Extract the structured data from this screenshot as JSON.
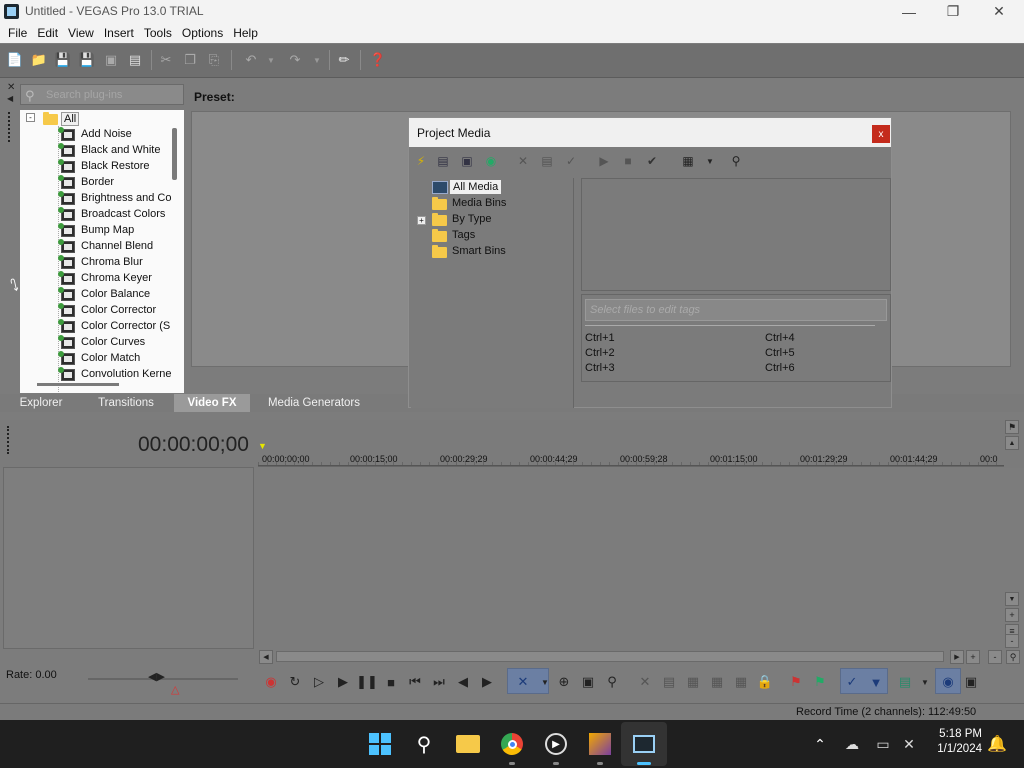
{
  "window": {
    "title": "Untitled - VEGAS Pro 13.0 TRIAL",
    "controls": [
      "minimize",
      "maximize",
      "close"
    ]
  },
  "menu": [
    "File",
    "Edit",
    "View",
    "Insert",
    "Tools",
    "Options",
    "Help"
  ],
  "plugins": {
    "search_placeholder": "Search plug-ins",
    "root": "All",
    "items": [
      "Add Noise",
      "Black and White",
      "Black Restore",
      "Border",
      "Brightness and Co",
      "Broadcast Colors",
      "Bump Map",
      "Channel Blend",
      "Chroma Blur",
      "Chroma Keyer",
      "Color Balance",
      "Color Corrector",
      "Color Corrector (S",
      "Color Curves",
      "Color Match",
      "Convolution Kerne"
    ]
  },
  "preset": {
    "label": "Preset:"
  },
  "tabs": [
    "Explorer",
    "Transitions",
    "Video FX",
    "Media Generators"
  ],
  "active_tab": "Video FX",
  "project_media": {
    "title": "Project Media",
    "close": "x",
    "tree": [
      "All Media",
      "Media Bins",
      "By Type",
      "Tags",
      "Smart Bins"
    ],
    "tags_placeholder": "Select files to edit tags",
    "shortcuts_left": [
      "Ctrl+1",
      "Ctrl+2",
      "Ctrl+3"
    ],
    "shortcuts_right": [
      "Ctrl+4",
      "Ctrl+5",
      "Ctrl+6"
    ]
  },
  "timeline": {
    "timecode": "00:00:00;00",
    "ruler": [
      "00:00:00;00",
      "00:00:15;00",
      "00:00:29;29",
      "00:00:44;29",
      "00:00:59;28",
      "00:01:15;00",
      "00:01:29;29",
      "00:01:44;29",
      "00:0"
    ]
  },
  "transport": {
    "rate": "Rate: 0.00"
  },
  "status": {
    "record_time": "Record Time (2 channels): 112:49:50"
  },
  "taskbar": {
    "time": "5:18 PM",
    "date": "1/1/2024"
  }
}
